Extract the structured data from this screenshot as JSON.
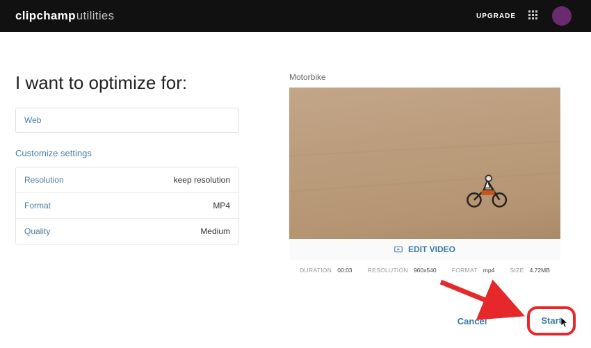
{
  "brand": {
    "bold": "clipchamp",
    "light": "utilities"
  },
  "header": {
    "upgrade": "UPGRADE"
  },
  "left": {
    "heading": "I want to optimize for:",
    "preset": "Web",
    "customize_label": "Customize settings",
    "rows": [
      {
        "label": "Resolution",
        "value": "keep resolution"
      },
      {
        "label": "Format",
        "value": "MP4"
      },
      {
        "label": "Quality",
        "value": "Medium"
      }
    ]
  },
  "right": {
    "video_title": "Motorbike",
    "edit_label": "EDIT VIDEO",
    "meta": {
      "duration_k": "DURATION",
      "duration_v": "00:03",
      "resolution_k": "RESOLUTION",
      "resolution_v": "960x540",
      "format_k": "FORMAT",
      "format_v": "mp4",
      "size_k": "SIZE",
      "size_v": "4.72MB"
    }
  },
  "actions": {
    "cancel": "Cancel",
    "start": "Start"
  },
  "annotation": {
    "highlight_color": "#e6282a"
  }
}
